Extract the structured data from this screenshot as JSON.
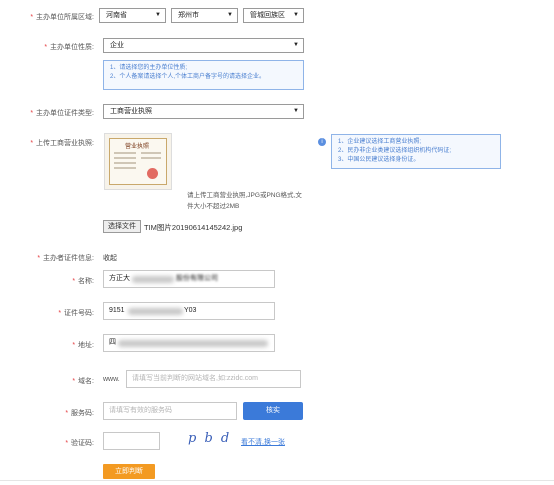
{
  "region": {
    "label": "主办单位所属区域:",
    "province": "河南省",
    "city": "郑州市",
    "district": "管城回族区"
  },
  "nature": {
    "label": "主办单位性质:",
    "value": "企业",
    "tips": [
      "1、请选择您的主办单位性质;",
      "2、个人备案请选择个人,个体工商户备字号的请选择企业。"
    ]
  },
  "cert_type": {
    "label": "主办单位证件类型:",
    "value": "工商营业执照"
  },
  "upload": {
    "label": "上传工商营业执照:",
    "license_title": "营业执照",
    "hint_line1": "请上传工商营业执照,JPG或PNG格式,文",
    "hint_line2": "件大小不超过2MB",
    "choose_button": "选择文件",
    "file_name": "TIM图片20190614145242.jpg",
    "info_icon": "info-icon",
    "tips": [
      "1、企业建议选择工商营业执照;",
      "2、民办非企业类建议选择组织机构代码证;",
      "3、中国公民建议选择身份证。"
    ]
  },
  "holder_info": {
    "label": "主办者证件信息:",
    "value": "收起"
  },
  "name": {
    "label": "名称:",
    "prefix": "方正大",
    "suffix": "股份有限公司"
  },
  "cert_no": {
    "label": "证件号码:",
    "prefix": "9151",
    "suffix": "Y03"
  },
  "address": {
    "label": "地址:",
    "prefix": "四"
  },
  "domain": {
    "label": "域名:",
    "prefix": "www.",
    "placeholder": "请填写当前判断的网站域名,如:zzidc.com"
  },
  "service_code": {
    "label": "服务码:",
    "placeholder": "请填写有效的服务码",
    "button": "核实"
  },
  "captcha": {
    "label": "验证码:",
    "image_text": "p b d",
    "refresh": "看不清,换一张"
  },
  "submit": {
    "label": "立即判断"
  },
  "colors": {
    "required": "#e4393c",
    "accent": "#3b7ad9",
    "submit": "#f39a22",
    "tip_text": "#4a7fd0"
  }
}
